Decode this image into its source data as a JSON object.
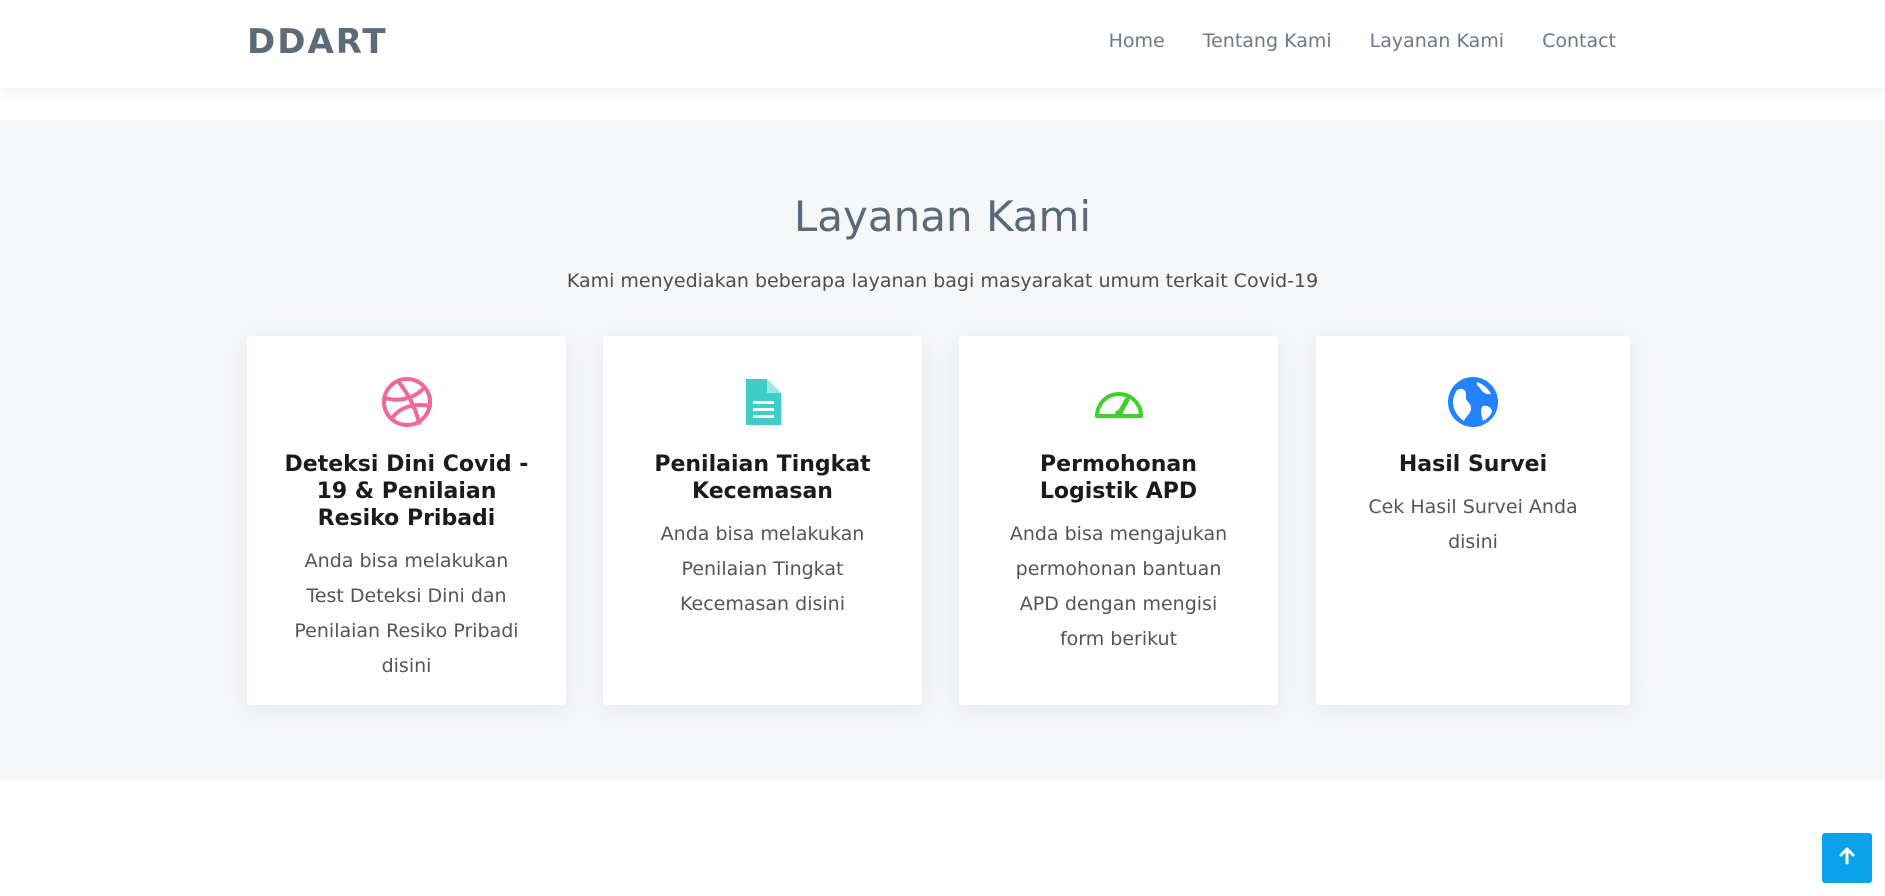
{
  "header": {
    "logo": "DDART",
    "nav": [
      "Home",
      "Tentang Kami",
      "Layanan Kami",
      "Contact"
    ]
  },
  "services": {
    "title": "Layanan Kami",
    "subtitle": "Kami menyediakan beberapa layanan bagi masyarakat umum terkait Covid-19",
    "cards": [
      {
        "icon": "dribbble-icon",
        "color": "#f06896",
        "title": "Deteksi Dini Covid - 19 & Penilaian Resiko Pribadi",
        "desc": "Anda bisa melakukan Test Deteksi Dini dan Penilaian Resiko Pribadi disini"
      },
      {
        "icon": "file-text-icon",
        "color": "#3fcdc7",
        "title": "Penilaian Tingkat Kecemasan",
        "desc": "Anda bisa melakukan Penilaian Tingkat Kecemasan disini"
      },
      {
        "icon": "speedometer-icon",
        "color": "#41cf2e",
        "title": "Permohonan Logistik APD",
        "desc": "Anda bisa mengajukan permohonan bantuan APD dengan mengisi form berikut"
      },
      {
        "icon": "globe-icon",
        "color": "#2282ff",
        "title": "Hasil Survei",
        "desc": "Cek Hasil Survei Anda disini"
      }
    ]
  },
  "back_to_top": {
    "icon": "arrow-up-icon",
    "color": "#0aa2eb"
  }
}
